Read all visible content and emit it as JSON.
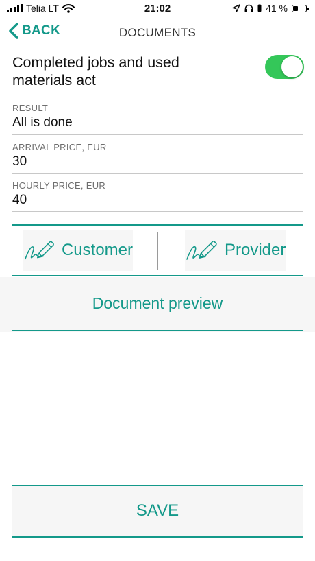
{
  "status_bar": {
    "carrier": "Telia LT",
    "time": "21:02",
    "battery_percent": "41 %",
    "battery_level": 0.41,
    "icons": [
      "signal-icon",
      "wifi-icon",
      "location-icon",
      "headphones-icon",
      "battery-icon"
    ]
  },
  "nav": {
    "back_label": "BACK",
    "title": "DOCUMENTS"
  },
  "document": {
    "title": "Completed jobs and used materials act",
    "toggle_on": true
  },
  "fields": [
    {
      "label": "RESULT",
      "value": "All is done"
    },
    {
      "label": "ARRIVAL PRICE, EUR",
      "value": "30"
    },
    {
      "label": "HOURLY PRICE, EUR",
      "value": "40"
    }
  ],
  "signatures": {
    "customer_label": "Customer",
    "provider_label": "Provider"
  },
  "preview": {
    "label": "Document preview"
  },
  "save": {
    "label": "SAVE"
  },
  "colors": {
    "accent": "#14998a",
    "toggle_on": "#34c759",
    "button_bg": "#f6f6f6",
    "label_gray": "#6e6e6e"
  }
}
